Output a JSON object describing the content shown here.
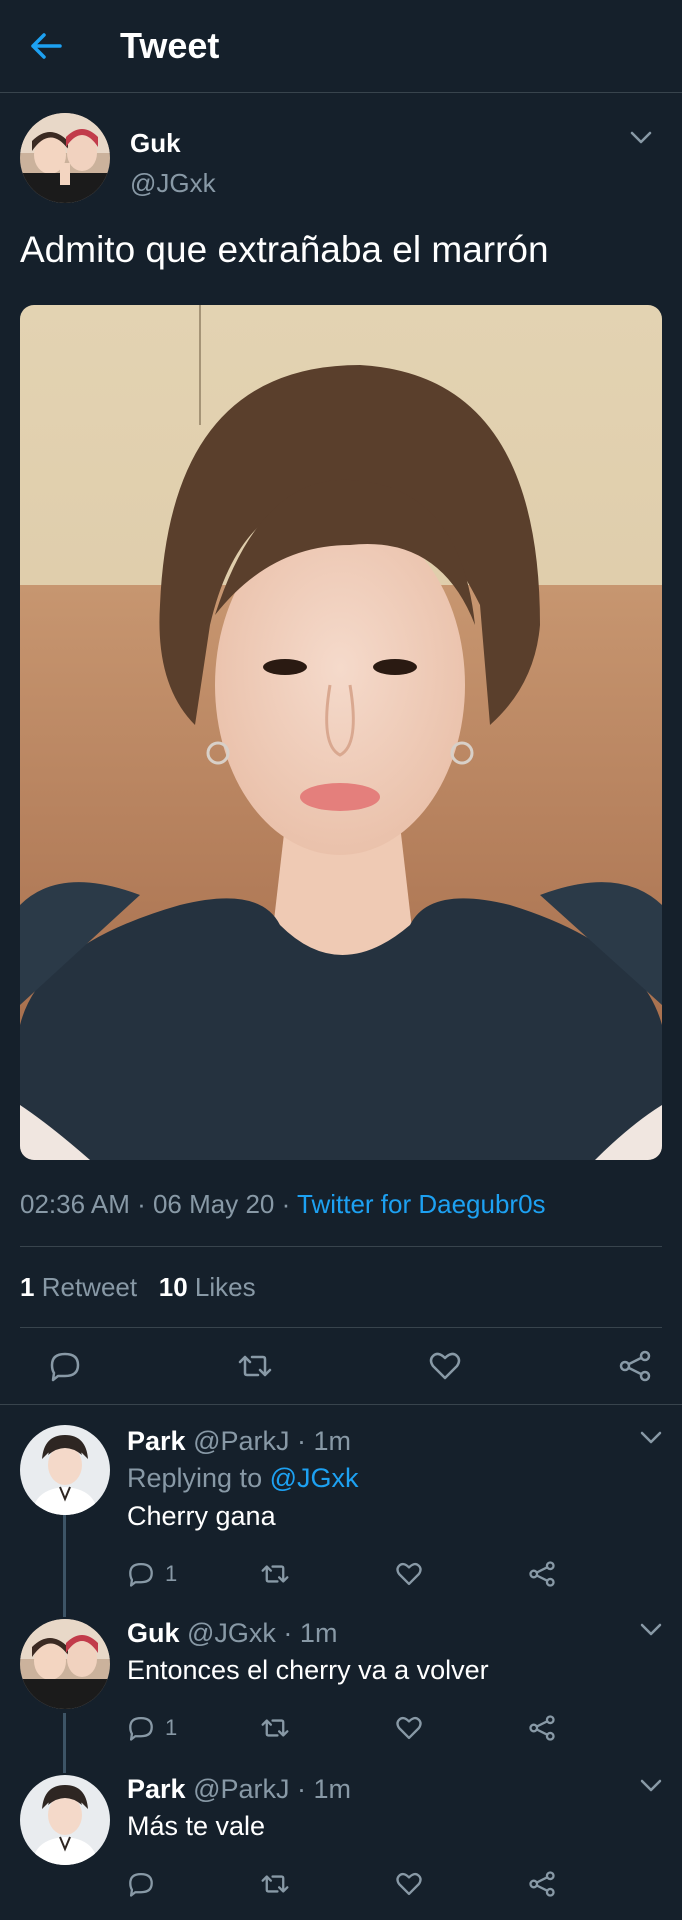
{
  "header": {
    "title": "Tweet",
    "back_icon": "arrow-left-icon"
  },
  "tweet": {
    "author": {
      "display_name": "Guk",
      "handle": "@JGxk"
    },
    "text": "Admito que extrañaba el marrón",
    "timestamp": "02:36 AM · 06 May 20 · ",
    "source": "Twitter for Daegubr0s",
    "stats": {
      "retweets_count": "1",
      "retweets_label": "Retweet",
      "likes_count": "10",
      "likes_label": "Likes"
    },
    "actions": [
      "reply-icon",
      "retweet-icon",
      "like-icon",
      "share-icon"
    ]
  },
  "replies": [
    {
      "name": "Park",
      "meta": " @ParkJ · 1m",
      "replying_label": "Replying to ",
      "replying_handle": "@JGxk",
      "text": "Cherry gana",
      "reply_count": "1"
    },
    {
      "name": "Guk",
      "meta": " @JGxk · 1m",
      "text": "Entonces el cherry va a volver",
      "reply_count": "1"
    },
    {
      "name": "Park",
      "meta": " @ParkJ · 1m",
      "text": "Más te vale",
      "reply_count": ""
    }
  ],
  "colors": {
    "background": "#15202b",
    "accent": "#1da1f2",
    "secondary_text": "#8899a6",
    "divider": "#38444d"
  }
}
